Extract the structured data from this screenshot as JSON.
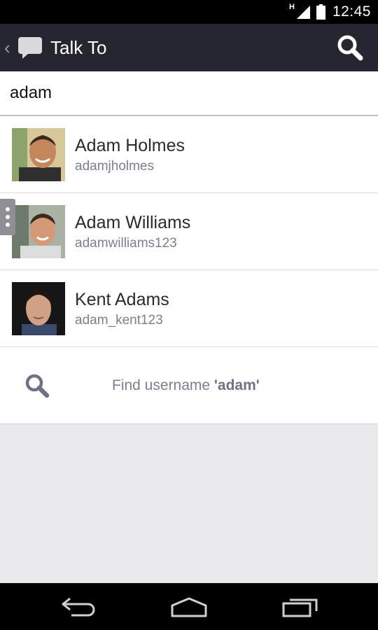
{
  "status_bar": {
    "network": "H",
    "time": "12:45",
    "icons": [
      "signal-icon",
      "battery-icon"
    ]
  },
  "action_bar": {
    "title": "Talk To",
    "icons": [
      "up-caret-icon",
      "chat-bubble-icon",
      "search-icon"
    ]
  },
  "search": {
    "value": "adam"
  },
  "contacts": [
    {
      "name": "Adam Holmes",
      "username": "adamjholmes"
    },
    {
      "name": "Adam Williams",
      "username": "adamwilliams123"
    },
    {
      "name": "Kent Adams",
      "username": "adam_kent123"
    }
  ],
  "find_username": {
    "prefix": "Find username ",
    "quote_open": "'",
    "term": "adam",
    "quote_close": "'"
  },
  "nav_bar": {
    "icons": [
      "back-icon",
      "home-icon",
      "recents-icon"
    ]
  },
  "colors": {
    "action_bar_bg": "#262630",
    "list_bg": "#ffffff",
    "empty_bg": "#e9e9ee",
    "secondary_text": "#7b8091"
  }
}
